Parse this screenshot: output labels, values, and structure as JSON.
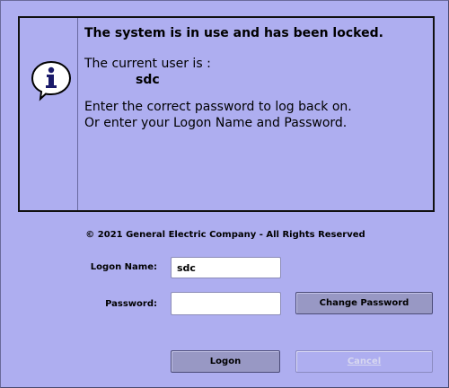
{
  "message": {
    "title": "The system is in use and has been locked.",
    "current_user_label": "The current user is :",
    "current_user": "sdc",
    "instruction_line1": "Enter the correct password to log back on.",
    "instruction_line2": "Or enter your Logon Name and Password."
  },
  "icons": {
    "info": "info-icon"
  },
  "copyright": "© 2021 General Electric Company - All Rights Reserved",
  "form": {
    "logon_name_label": "Logon Name:",
    "logon_name_value": "sdc",
    "password_label": "Password:",
    "password_value": "",
    "change_password_label": "Change Password"
  },
  "buttons": {
    "logon": "Logon",
    "cancel": "Cancel"
  },
  "colors": {
    "background": "#aeaef0",
    "button": "#9898c4",
    "disabled_text": "#d8d8f0"
  }
}
